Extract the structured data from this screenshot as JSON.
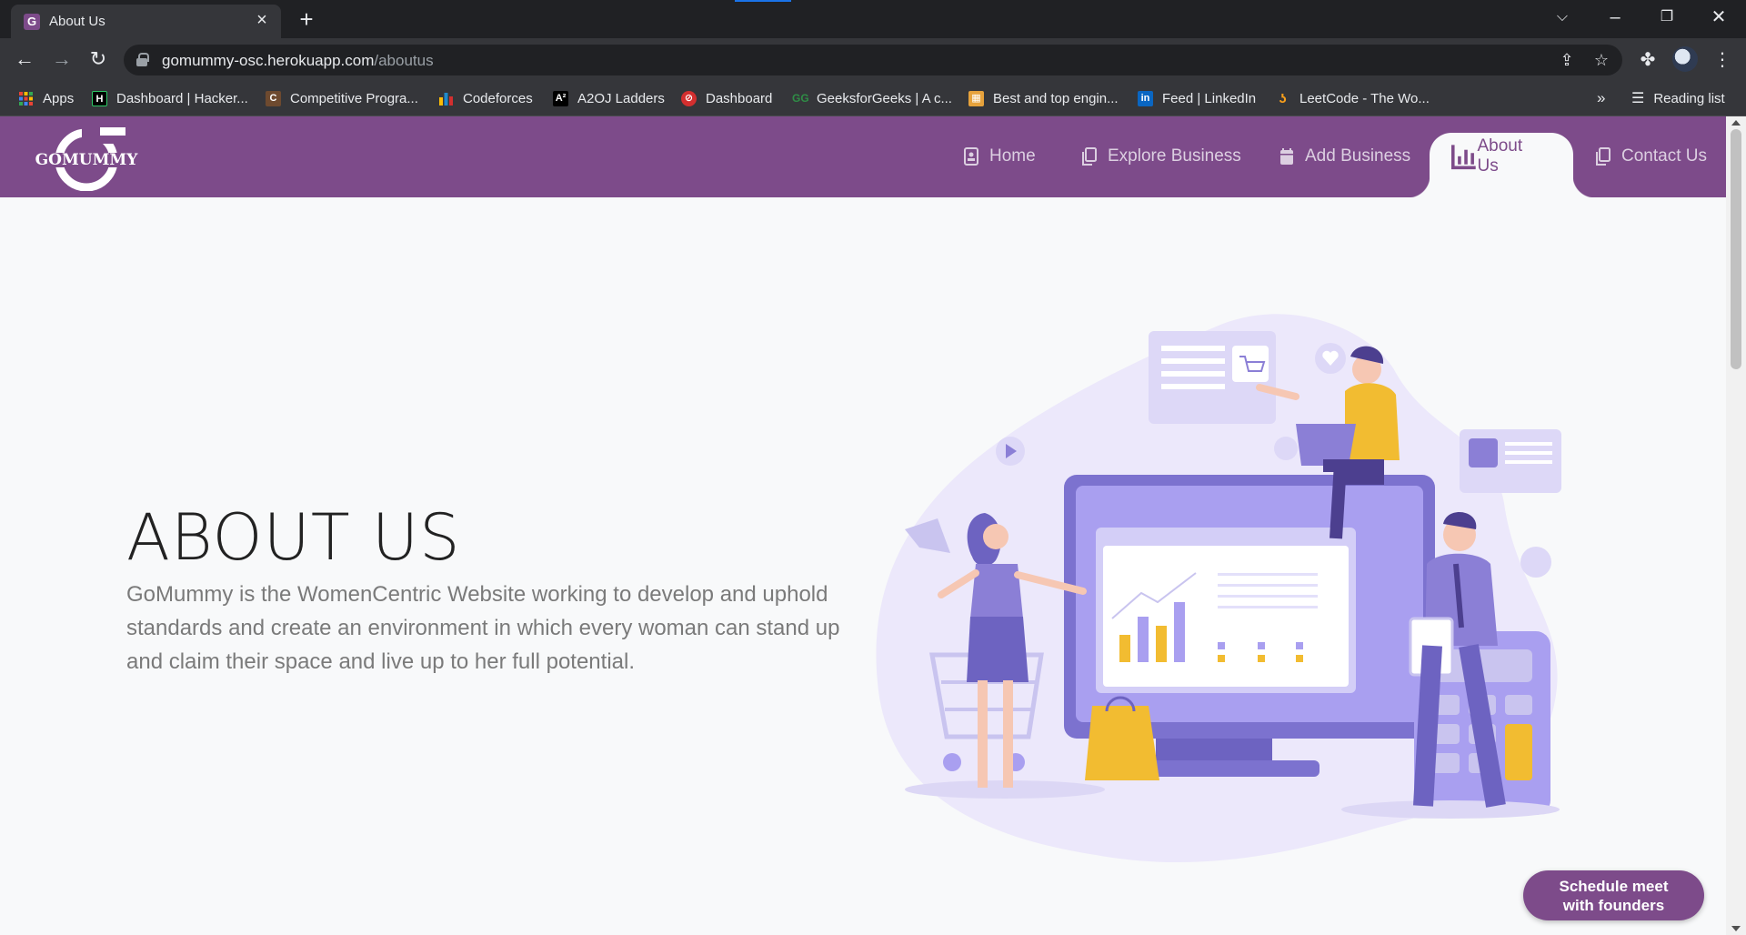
{
  "browser": {
    "tab_title": "About Us",
    "tab_favicon_letter": "G",
    "url_host": "gomummy-osc.herokuapp.com",
    "url_path": "/aboutus",
    "reading_list": "Reading list",
    "bookmarks_overflow": "»",
    "bookmarks": [
      {
        "label": "Apps",
        "icon": "apps-grid-icon",
        "color": "#ea4335"
      },
      {
        "label": "Dashboard | Hacker...",
        "icon": "hackerrank-icon",
        "color": "#000000"
      },
      {
        "label": "Competitive Progra...",
        "icon": "codechef-icon",
        "color": "#6e4a2f"
      },
      {
        "label": "Codeforces",
        "icon": "codeforces-icon",
        "color": "#1f8acb"
      },
      {
        "label": "A2OJ Ladders",
        "icon": "a2oj-icon",
        "color": "#000000"
      },
      {
        "label": "Dashboard",
        "icon": "dashboard-icon",
        "color": "#d32f2f"
      },
      {
        "label": "GeeksforGeeks | A c...",
        "icon": "geeksforgeeks-icon",
        "color": "#2f8d46"
      },
      {
        "label": "Best and top engin...",
        "icon": "engineering-icon",
        "color": "#e6a23c"
      },
      {
        "label": "Feed | LinkedIn",
        "icon": "linkedin-icon",
        "color": "#0a66c2"
      },
      {
        "label": "LeetCode - The Wo...",
        "icon": "leetcode-icon",
        "color": "#f89f1b"
      }
    ]
  },
  "site": {
    "logo_text": "GOMUMMY",
    "nav": [
      {
        "label": "Home",
        "icon": "home-icon"
      },
      {
        "label": "Explore Business",
        "icon": "copy-icon"
      },
      {
        "label": "Add Business",
        "icon": "calendar-icon"
      },
      {
        "label": "About Us",
        "icon": "chart-icon",
        "active": true
      },
      {
        "label": "Contact Us",
        "icon": "copy-icon"
      }
    ],
    "colors": {
      "brand": "#7d4b8a",
      "background": "#f8f9fa"
    }
  },
  "main": {
    "heading": "ABOUT US",
    "description": "GoMummy is the WomenCentric Website working to develop and uphold standards and create an environment in which every woman can stand up and claim their space and live up to her full potential."
  },
  "cta": {
    "line1": "Schedule meet",
    "line2": "with founders"
  }
}
